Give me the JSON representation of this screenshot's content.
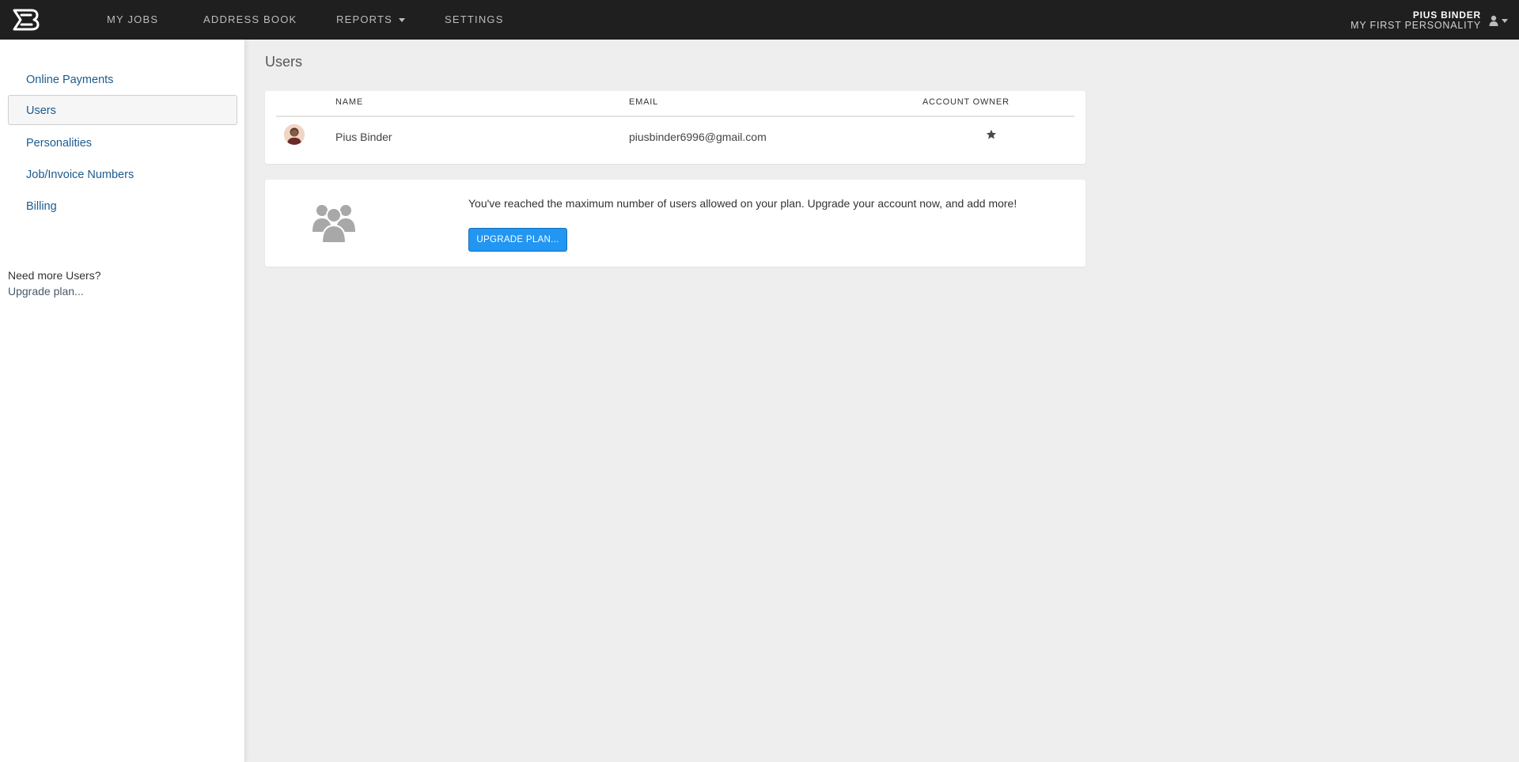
{
  "nav": {
    "logo_icon": "brand-logo-icon",
    "items": [
      {
        "label": "MY JOBS"
      },
      {
        "label": "ADDRESS BOOK"
      },
      {
        "label": "REPORTS"
      },
      {
        "label": "SETTINGS"
      }
    ],
    "user": {
      "name": "PIUS BINDER",
      "personality": "MY FIRST PERSONALITY",
      "icon": "user-icon"
    }
  },
  "sidebar": {
    "items": [
      {
        "label": "Online Payments",
        "active": false
      },
      {
        "label": "Users",
        "active": true
      },
      {
        "label": "Personalities",
        "active": false
      },
      {
        "label": "Job/Invoice Numbers",
        "active": false
      },
      {
        "label": "Billing",
        "active": false
      }
    ],
    "note": "Need more Users?",
    "link": "Upgrade plan..."
  },
  "main": {
    "title": "Users",
    "table": {
      "headers": [
        "NAME",
        "EMAIL",
        "ACCOUNT OWNER"
      ],
      "rows": [
        {
          "name": "Pius Binder",
          "email": "piusbinder6996@gmail.com",
          "owner_icon": "star-icon"
        }
      ]
    },
    "upgrade": {
      "message": "You've reached the maximum number of users allowed on your plan. Upgrade your account now, and add more!",
      "button": "UPGRADE PLAN..."
    }
  },
  "colors": {
    "topbar": "#1f1f20",
    "accent": "#2196f3",
    "link": "#1c5b8f"
  }
}
